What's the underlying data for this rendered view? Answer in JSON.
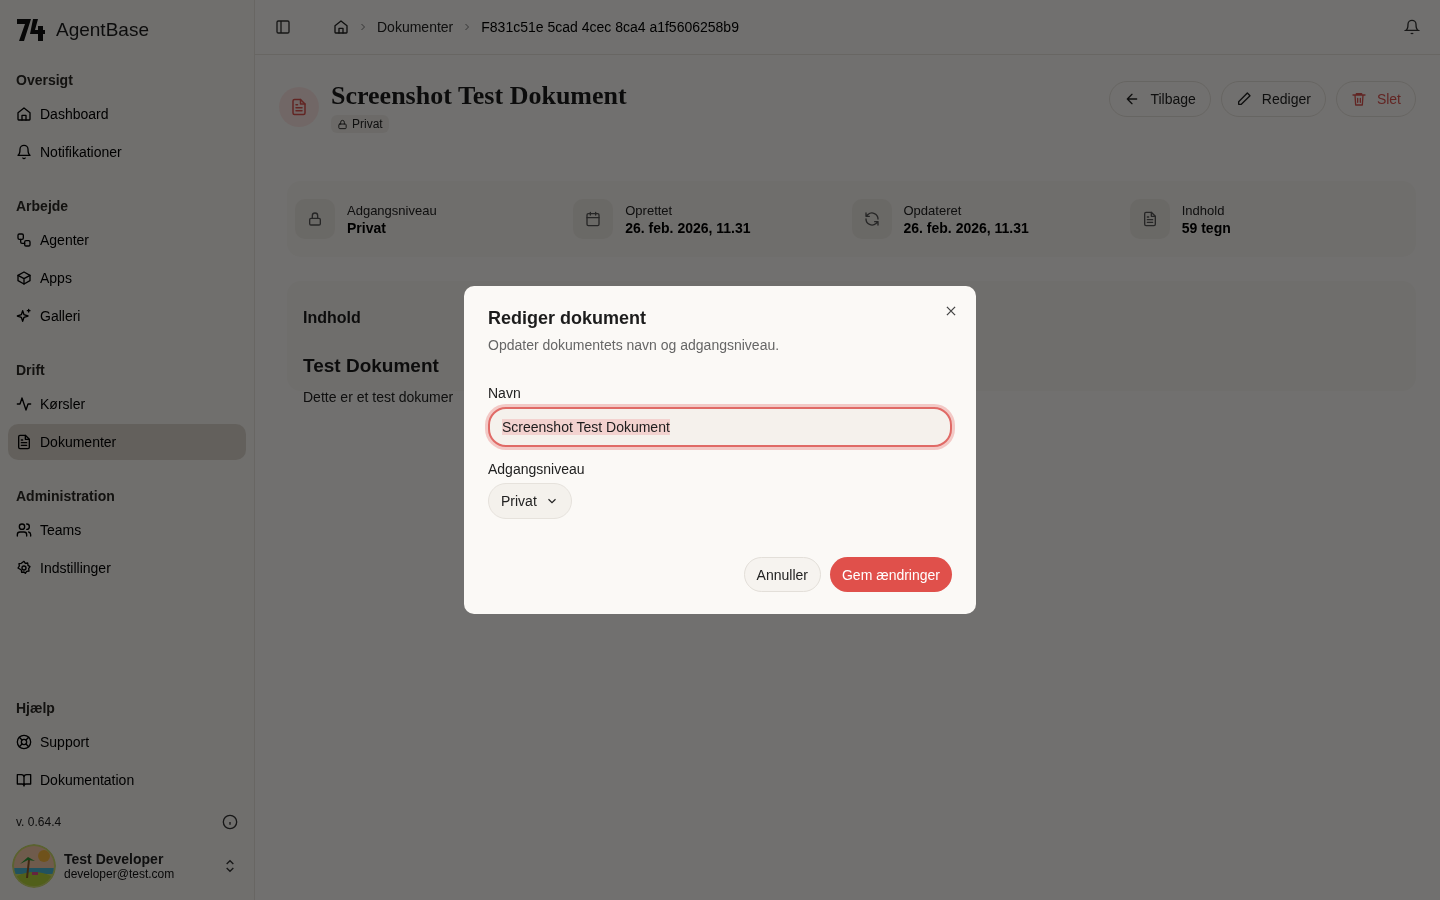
{
  "sidebar": {
    "brand": "AgentBase",
    "sections": [
      {
        "title": "Oversigt",
        "items": [
          {
            "label": "Dashboard",
            "kind": "home",
            "selected": false
          },
          {
            "label": "Notifikationer",
            "kind": "bell",
            "selected": false
          }
        ]
      },
      {
        "title": "Arbejde",
        "items": [
          {
            "label": "Agenter",
            "kind": "workflow",
            "selected": false
          },
          {
            "label": "Apps",
            "kind": "box",
            "selected": false
          },
          {
            "label": "Galleri",
            "kind": "sparkles",
            "selected": false
          }
        ]
      },
      {
        "title": "Drift",
        "items": [
          {
            "label": "Kørsler",
            "kind": "activity",
            "selected": false
          },
          {
            "label": "Dokumenter",
            "kind": "file",
            "selected": true
          }
        ]
      },
      {
        "title": "Administration",
        "items": [
          {
            "label": "Teams",
            "kind": "users",
            "selected": false
          },
          {
            "label": "Indstillinger",
            "kind": "gear",
            "selected": false
          }
        ]
      }
    ],
    "help": {
      "title": "Hjælp",
      "items": [
        {
          "label": "Support",
          "kind": "lifebuoy",
          "selected": false
        },
        {
          "label": "Dokumentation",
          "kind": "book",
          "selected": false
        }
      ]
    },
    "version": "v. 0.64.4",
    "user": {
      "name": "Test Developer",
      "email": "developer@test.com"
    }
  },
  "breadcrumb": [
    "Dokumenter",
    "F831c51e 5cad 4cec 8ca4 a1f5606258b9"
  ],
  "header": {
    "title": "Screenshot Test Dokument",
    "badge": "Privat",
    "actions": [
      {
        "label": "Tilbage",
        "kind": "back"
      },
      {
        "label": "Rediger",
        "kind": "edit"
      },
      {
        "label": "Slet",
        "kind": "delete"
      }
    ]
  },
  "stats": [
    {
      "label": "Adgangsniveau",
      "value": "Privat",
      "kind": "lock"
    },
    {
      "label": "Oprettet",
      "value": "26. feb. 2026, 11.31",
      "kind": "calendar"
    },
    {
      "label": "Opdateret",
      "value": "26. feb. 2026, 11.31",
      "kind": "refresh"
    },
    {
      "label": "Indhold",
      "value": "59 tegn",
      "kind": "file"
    }
  ],
  "content": {
    "heading": "Indhold",
    "doc_title": "Test Dokument",
    "doc_text": "Dette er et test dokumer"
  },
  "dialog": {
    "title": "Rediger dokument",
    "description": "Opdater dokumentets navn og adgangsniveau.",
    "name_label": "Navn",
    "name_value": "Screenshot Test Dokument",
    "access_label": "Adgangsniveau",
    "access_value": "Privat",
    "buttons": [
      {
        "label": "Annuller",
        "kind": "secondary"
      },
      {
        "label": "Gem ændringer",
        "kind": "primary"
      }
    ]
  }
}
